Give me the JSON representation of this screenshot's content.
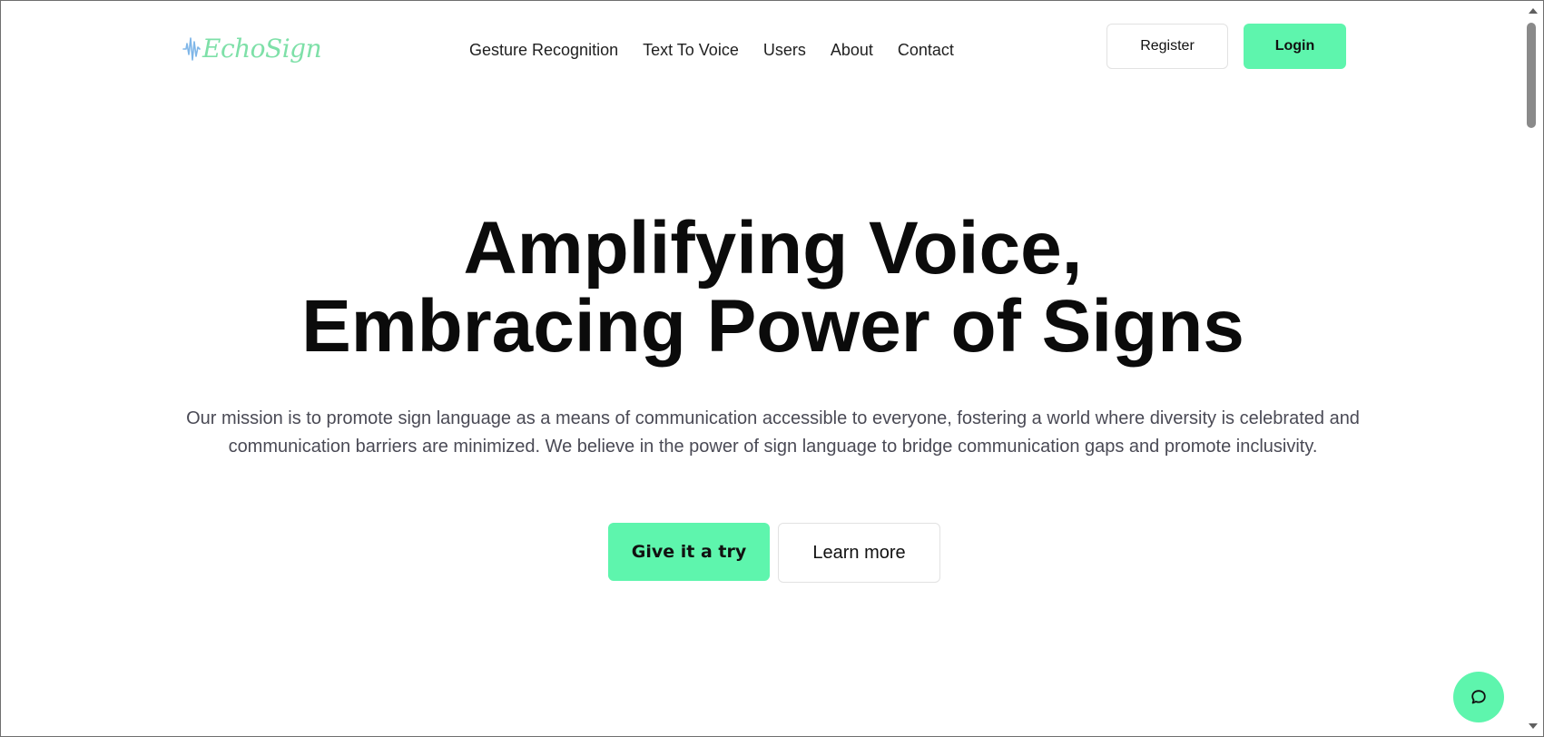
{
  "header": {
    "logo_text": "EchoSign",
    "nav": [
      {
        "label": "Gesture Recognition"
      },
      {
        "label": "Text To Voice"
      },
      {
        "label": "Users"
      },
      {
        "label": "About"
      },
      {
        "label": "Contact"
      }
    ],
    "register_label": "Register",
    "login_label": "Login"
  },
  "hero": {
    "title_line1": "Amplifying Voice,",
    "title_line2": "Embracing Power of Signs",
    "mission": "Our mission is to promote sign language as a means of communication accessible to everyone, fostering a world where diversity is celebrated and communication barriers are minimized. We believe in the power of sign language to bridge communication gaps and promote inclusivity.",
    "try_label": "Give it a try",
    "learn_label": "Learn more"
  },
  "chat": {
    "icon": "chat-bubble-icon"
  },
  "colors": {
    "accent": "#5ef5ad",
    "logo": "#7ee0a8",
    "logo_wave": "#7fb6e8",
    "text": "#0b0b0b",
    "muted_text": "#4a4a55"
  }
}
